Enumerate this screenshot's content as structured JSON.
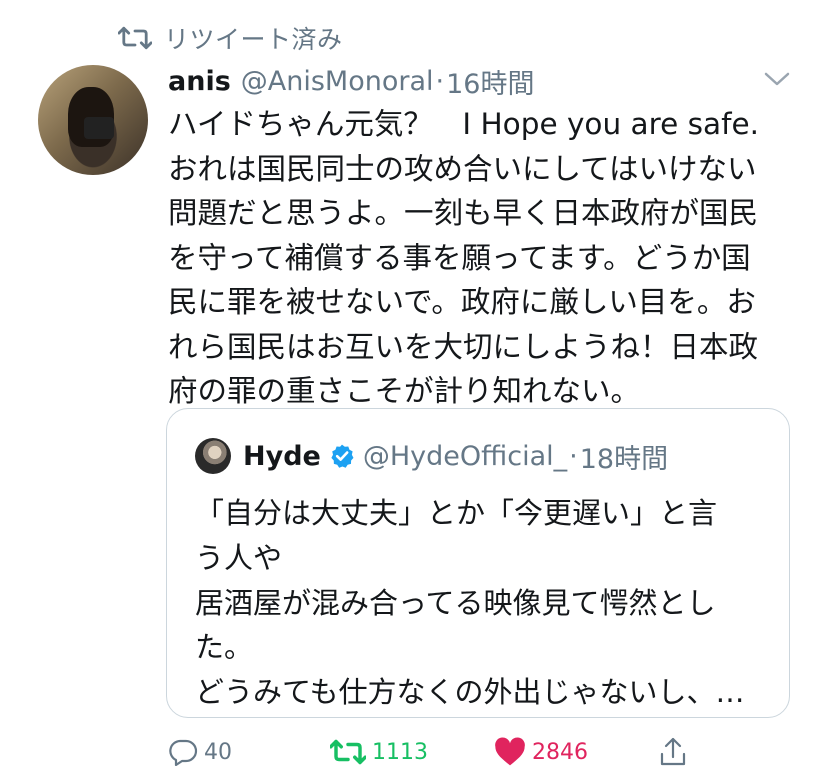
{
  "retweet_context": {
    "label": "リツイート済み",
    "icon": "retweet-icon"
  },
  "tweet": {
    "display_name": "anis",
    "handle": "@AnisMonoral",
    "separator": "·",
    "time": "16時間",
    "text_lines": [
      "ハイドちゃん元気？　I Hope you are safe.",
      "おれは国民同士の攻め合いにしてはいけない",
      "問題だと思うよ。一刻も早く日本政府が国民",
      "を守って補償する事を願ってます。どうか国",
      "民に罪を被せないで。政府に厳しい目を。お",
      "れら国民はお互いを大切にしようね！日本政",
      "府の罪の重さこそが計り知れない。"
    ]
  },
  "quote": {
    "display_name": "Hyde",
    "verified": true,
    "handle": "@HydeOfficial_",
    "separator": "·",
    "time": "18時間",
    "text_lines": [
      "「自分は大丈夫」とか「今更遅い」と言",
      "う人や",
      "居酒屋が混み合ってる映像見て愕然とし",
      "た。",
      "どうみても仕方なくの外出じゃないし、…"
    ]
  },
  "actions": {
    "reply_count": "40",
    "retweet_count": "1113",
    "like_count": "2846",
    "retweeted": true,
    "liked": true
  },
  "colors": {
    "text": "#14171a",
    "secondary": "#657786",
    "retweet_active": "#17bf63",
    "like_active": "#e0245e",
    "verified": "#1da1f2",
    "border": "#ccd6dd"
  }
}
